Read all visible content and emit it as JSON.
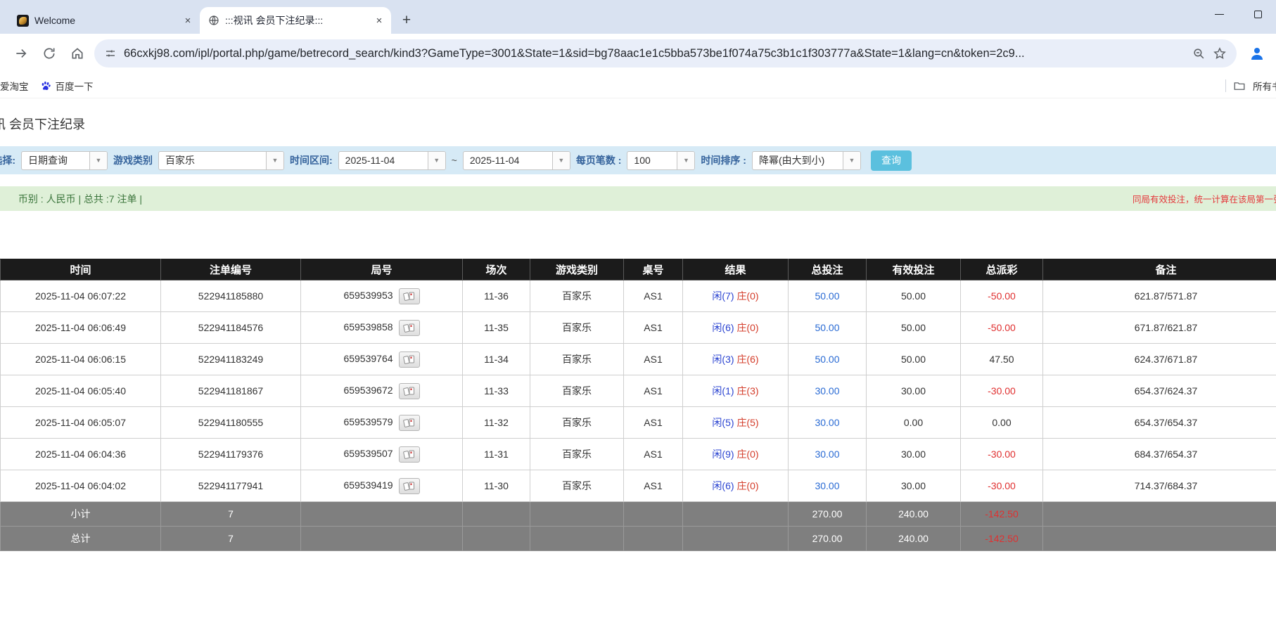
{
  "tabs": [
    {
      "title": "Welcome",
      "favicon": "dragon-logo"
    },
    {
      "title": ":::视讯 会员下注纪录:::",
      "favicon": "globe",
      "active": true
    }
  ],
  "toolbar": {
    "url": "66cxkj98.com/ipl/portal.php/game/betrecord_search/kind3?GameType=3001&State=1&sid=bg78aac1e1c5bba573be1f074a75c3b1c1f303777a&State=1&lang=cn&token=2c9..."
  },
  "bookmarks": {
    "items": [
      {
        "label": "爱淘宝"
      },
      {
        "label": "百度一下"
      }
    ],
    "right_label": "所有书签"
  },
  "page": {
    "title_prefix": "视讯",
    "title": "会员下注纪录",
    "filters": {
      "select_label": "查询选择:",
      "select_value": "日期查询",
      "game_type_label": "游戏类别",
      "game_type_value": "百家乐",
      "date_range_label": "时间区间:",
      "date_from": "2025-11-04",
      "tilde": "~",
      "date_to": "2025-11-04",
      "page_size_label": "每页笔数 :",
      "page_size_value": "100",
      "sort_label": "时间排序 :",
      "sort_value": "降幂(由大到小)",
      "search_button": "查询"
    },
    "summary_bar": {
      "left_text": "币别 : 人民币 | 总共 :7 注单 |",
      "right_note": "同局有效投注，统一计算在该局第一张注单"
    },
    "table": {
      "columns": [
        "时间",
        "注单编号",
        "局号",
        "场次",
        "游戏类别",
        "桌号",
        "结果",
        "总投注",
        "有效投注",
        "总派彩",
        "备注"
      ],
      "rows": [
        {
          "time": "2025-11-04 06:07:22",
          "bet_no": "522941185880",
          "round_no": "659539953",
          "session": "11-36",
          "game": "百家乐",
          "table_no": "AS1",
          "result_player": "闲(7)",
          "result_banker": "庄(0)",
          "total_bet": "50.00",
          "valid_bet": "50.00",
          "payout": "-50.00",
          "note": "621.87/571.87"
        },
        {
          "time": "2025-11-04 06:06:49",
          "bet_no": "522941184576",
          "round_no": "659539858",
          "session": "11-35",
          "game": "百家乐",
          "table_no": "AS1",
          "result_player": "闲(6)",
          "result_banker": "庄(0)",
          "total_bet": "50.00",
          "valid_bet": "50.00",
          "payout": "-50.00",
          "note": "671.87/621.87"
        },
        {
          "time": "2025-11-04 06:06:15",
          "bet_no": "522941183249",
          "round_no": "659539764",
          "session": "11-34",
          "game": "百家乐",
          "table_no": "AS1",
          "result_player": "闲(3)",
          "result_banker": "庄(6)",
          "total_bet": "50.00",
          "valid_bet": "50.00",
          "payout": "47.50",
          "note": "624.37/671.87"
        },
        {
          "time": "2025-11-04 06:05:40",
          "bet_no": "522941181867",
          "round_no": "659539672",
          "session": "11-33",
          "game": "百家乐",
          "table_no": "AS1",
          "result_player": "闲(1)",
          "result_banker": "庄(3)",
          "total_bet": "30.00",
          "valid_bet": "30.00",
          "payout": "-30.00",
          "note": "654.37/624.37"
        },
        {
          "time": "2025-11-04 06:05:07",
          "bet_no": "522941180555",
          "round_no": "659539579",
          "session": "11-32",
          "game": "百家乐",
          "table_no": "AS1",
          "result_player": "闲(5)",
          "result_banker": "庄(5)",
          "total_bet": "30.00",
          "valid_bet": "0.00",
          "payout": "0.00",
          "note": "654.37/654.37"
        },
        {
          "time": "2025-11-04 06:04:36",
          "bet_no": "522941179376",
          "round_no": "659539507",
          "session": "11-31",
          "game": "百家乐",
          "table_no": "AS1",
          "result_player": "闲(9)",
          "result_banker": "庄(0)",
          "total_bet": "30.00",
          "valid_bet": "30.00",
          "payout": "-30.00",
          "note": "684.37/654.37"
        },
        {
          "time": "2025-11-04 06:04:02",
          "bet_no": "522941177941",
          "round_no": "659539419",
          "session": "11-30",
          "game": "百家乐",
          "table_no": "AS1",
          "result_player": "闲(6)",
          "result_banker": "庄(0)",
          "total_bet": "30.00",
          "valid_bet": "30.00",
          "payout": "-30.00",
          "note": "714.37/684.37"
        }
      ],
      "subtotal": {
        "label": "小计",
        "count": "7",
        "total_bet": "270.00",
        "valid_bet": "240.00",
        "payout": "-142.50"
      },
      "total": {
        "label": "总计",
        "count": "7",
        "total_bet": "270.00",
        "valid_bet": "240.00",
        "payout": "-142.50"
      }
    },
    "colors": {
      "accent_button": "#5bc0de",
      "link_blue": "#2a6bd4",
      "player_blue": "#2b44d1",
      "banker_red": "#d43c2a",
      "negative_red": "#e03030",
      "filter_bar_bg": "#d6eaf6",
      "summary_bar_bg": "#dff0d8",
      "header_bg": "#1b1b1b",
      "subtotal_bg": "#7f7f7f"
    }
  }
}
